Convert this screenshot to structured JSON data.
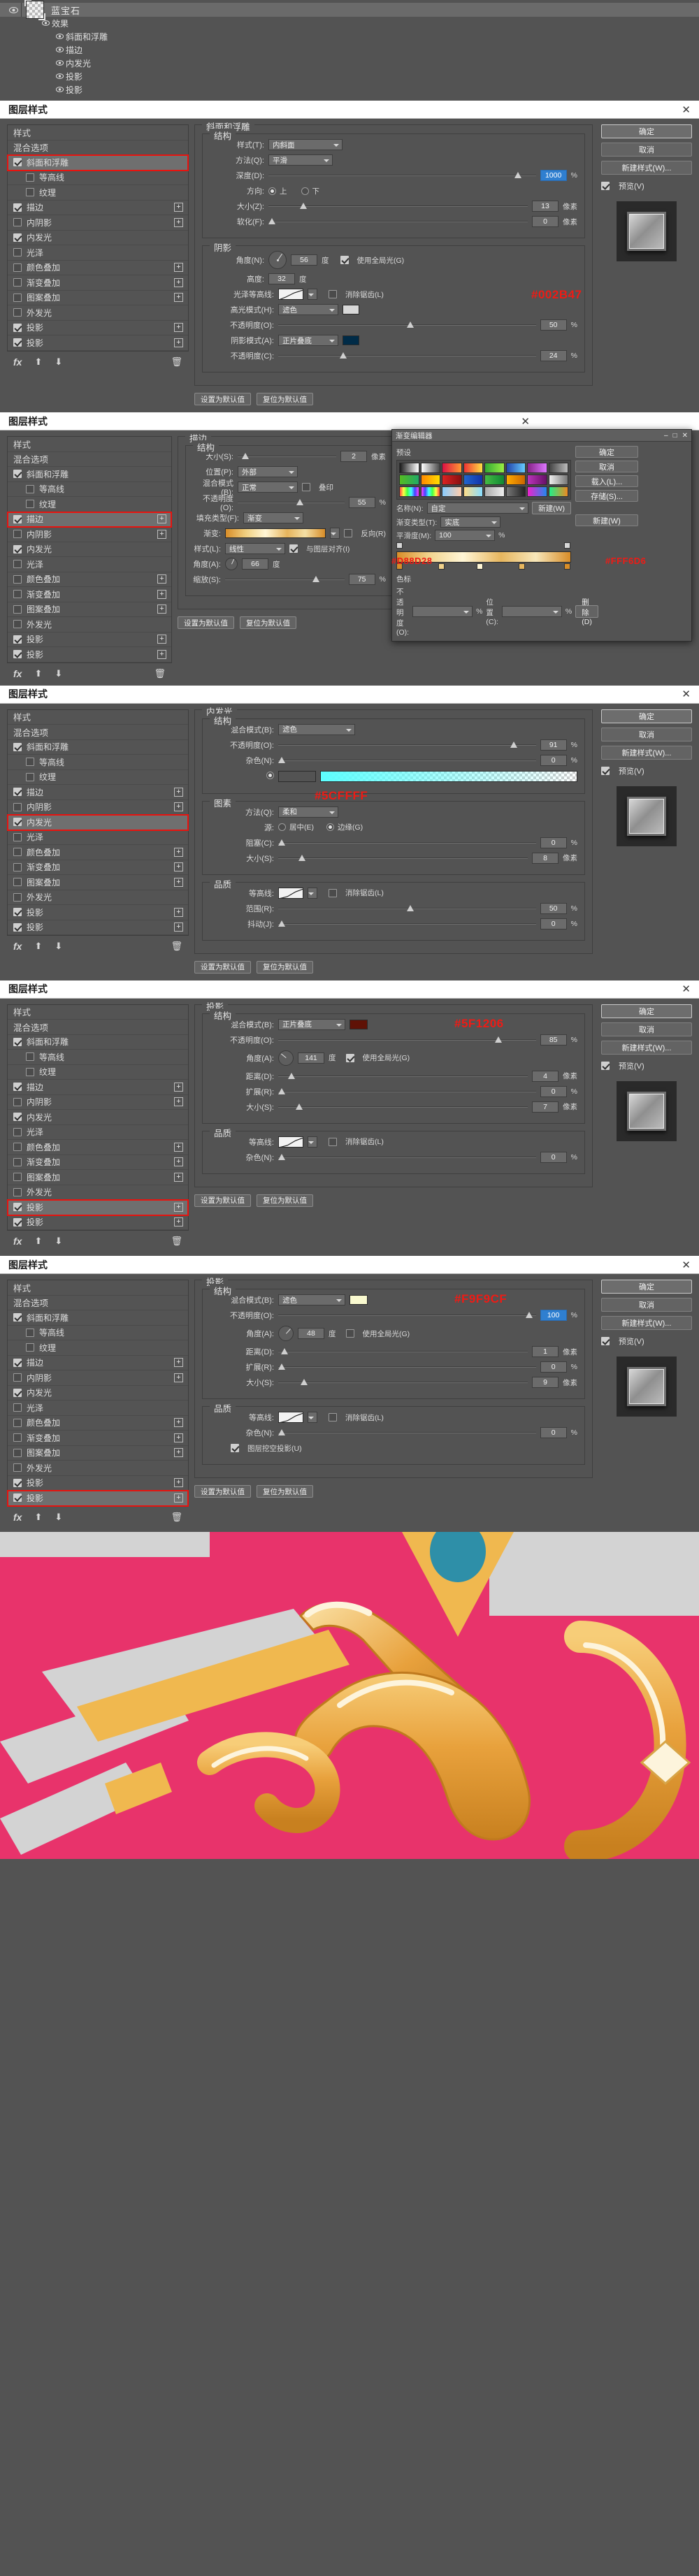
{
  "layers_panel": {
    "layer_name": "蓝宝石",
    "effects_label": "效果",
    "effects": [
      "斜面和浮雕",
      "描边",
      "内发光",
      "投影",
      "投影"
    ]
  },
  "dialog_common": {
    "title": "图层样式",
    "close": "✕",
    "buttons": {
      "ok": "确定",
      "cancel": "取消",
      "new_style": "新建样式(W)...",
      "preview": "预览(V)"
    },
    "footer": {
      "set_default": "设置为默认值",
      "reset_default": "复位为默认值"
    },
    "style_list_footer": {
      "fx": "fx",
      "up": "⬆",
      "down": "⬇",
      "trash": "🗑"
    },
    "style_items": [
      {
        "label": "样式",
        "type": "header"
      },
      {
        "label": "混合选项",
        "type": "header"
      },
      {
        "label": "斜面和浮雕",
        "type": "check",
        "checked": true,
        "plus": false
      },
      {
        "label": "等高线",
        "type": "check",
        "checked": false,
        "indent": true
      },
      {
        "label": "纹理",
        "type": "check",
        "checked": false,
        "indent": true
      },
      {
        "label": "描边",
        "type": "check",
        "checked": true,
        "plus": true
      },
      {
        "label": "内阴影",
        "type": "check",
        "checked": false,
        "plus": true
      },
      {
        "label": "内发光",
        "type": "check",
        "checked": true,
        "plus": false
      },
      {
        "label": "光泽",
        "type": "check",
        "checked": false,
        "plus": false
      },
      {
        "label": "颜色叠加",
        "type": "check",
        "checked": false,
        "plus": true
      },
      {
        "label": "渐变叠加",
        "type": "check",
        "checked": false,
        "plus": true
      },
      {
        "label": "图案叠加",
        "type": "check",
        "checked": false,
        "plus": false
      },
      {
        "label": "外发光",
        "type": "check",
        "checked": false,
        "plus": false
      },
      {
        "label": "投影",
        "type": "check",
        "checked": true,
        "plus": true
      },
      {
        "label": "投影",
        "type": "check",
        "checked": true,
        "plus": true
      }
    ]
  },
  "dialog1": {
    "selected_style": "斜面和浮雕",
    "group_title": "斜面和浮雕",
    "structure_title": "结构",
    "shading_title": "阴影",
    "fields": {
      "style_label": "样式(T):",
      "style_value": "内斜面",
      "technique_label": "方法(Q):",
      "technique_value": "平滑",
      "depth_label": "深度(D):",
      "depth_value": "1000",
      "depth_unit": "%",
      "direction_label": "方向:",
      "direction_up": "上",
      "direction_down": "下",
      "size_label": "大小(Z):",
      "size_value": "13",
      "size_unit": "像素",
      "soften_label": "软化(F):",
      "soften_value": "0",
      "soften_unit": "像素",
      "angle_label": "角度(N):",
      "angle_value": "56",
      "angle_unit": "度",
      "use_global_light": "使用全局光(G)",
      "altitude_label": "高度:",
      "altitude_value": "32",
      "altitude_unit": "度",
      "gloss_contour_label": "光泽等高线:",
      "antialias": "消除锯齿(L)",
      "highlight_mode_label": "高光模式(H):",
      "highlight_mode_value": "滤色",
      "highlight_opacity_label": "不透明度(O):",
      "highlight_opacity_value": "50",
      "highlight_opacity_unit": "%",
      "shadow_mode_label": "阴影模式(A):",
      "shadow_mode_value": "正片叠底",
      "shadow_opacity_label": "不透明度(C):",
      "shadow_opacity_value": "24",
      "shadow_opacity_unit": "%"
    },
    "colors": {
      "highlight": "#d8d8d8",
      "shadow": "#002b47"
    },
    "annotation": "#002B47"
  },
  "dialog2": {
    "selected_style": "描边",
    "group_title": "描边",
    "structure_title": "结构",
    "fields": {
      "size_label": "大小(S):",
      "size_value": "2",
      "size_unit": "像素",
      "position_label": "位置(P):",
      "position_value": "外部",
      "blend_label": "混合模式(B):",
      "blend_value": "正常",
      "opacity_label": "不透明度(O):",
      "opacity_value": "55",
      "opacity_unit": "%",
      "overprint_label": "叠印",
      "fill_type_label": "填充类型(F):",
      "fill_type_value": "渐变",
      "gradient_label": "渐变:",
      "reverse_label": "反向(R)",
      "style_label": "样式(L):",
      "style_value": "线性",
      "align_label": "与图层对齐(I)",
      "angle_label": "角度(A):",
      "angle_value": "66",
      "angle_unit": "度",
      "scale_label": "缩放(S):",
      "scale_value": "75",
      "scale_unit": "%"
    },
    "annotations": [
      "#D88D28",
      "#FFF6D6"
    ]
  },
  "gradient_picker": {
    "title": "渐变编辑器",
    "presets_label": "预设",
    "name_label": "名称(N):",
    "name_value": "自定",
    "new_label": "新建(W)",
    "grad_type_label": "渐变类型(T):",
    "grad_type_value": "实底",
    "smooth_label": "平滑度(M):",
    "smooth_value": "100",
    "smooth_unit": "%",
    "stops_label": "色标",
    "opacity_label": "不透明度(O):",
    "opacity_unit": "%",
    "location_label": "位置(C):",
    "location_unit": "%",
    "delete_label": "删除(D)",
    "buttons": {
      "ok": "确定",
      "cancel": "取消",
      "load": "载入(L)...",
      "save": "存储(S)...",
      "new": "新建(W)"
    },
    "stop_colors": [
      "#d88d28",
      "#f7e6b4",
      "#fff6d6",
      "#e3a84a",
      "#d88d28"
    ]
  },
  "dialog3": {
    "selected_style": "内发光",
    "group_title": "内发光",
    "structure_title": "结构",
    "quality_title": "品质",
    "fields": {
      "blend_label": "混合模式(B):",
      "blend_value": "滤色",
      "opacity_label": "不透明度(O):",
      "opacity_value": "91",
      "opacity_unit": "%",
      "noise_label": "杂色(N):",
      "noise_value": "0",
      "noise_unit": "%",
      "elements_title": "图素",
      "technique_label": "方法(Q):",
      "technique_value": "柔和",
      "source_label": "源:",
      "source_center": "居中(E)",
      "source_edge": "边缘(G)",
      "choke_label": "阻塞(C):",
      "choke_value": "0",
      "choke_unit": "%",
      "size_label": "大小(S):",
      "size_value": "8",
      "size_unit": "像素",
      "contour_label": "等高线:",
      "antialias": "消除锯齿(L)",
      "range_label": "范围(R):",
      "range_value": "50",
      "range_unit": "%",
      "jitter_label": "抖动(J):",
      "jitter_value": "0",
      "jitter_unit": "%"
    },
    "colors": {
      "glow": "#2ffff"
    },
    "annotation": "#5CFFFF"
  },
  "dialog4": {
    "selected_style": "投影",
    "group_title": "投影",
    "structure_title": "结构",
    "quality_title": "品质",
    "fields": {
      "blend_label": "混合模式(B):",
      "blend_value": "正片叠底",
      "opacity_label": "不透明度(O):",
      "opacity_value": "85",
      "opacity_unit": "%",
      "angle_label": "角度(A):",
      "angle_value": "141",
      "angle_unit": "度",
      "use_global_light": "使用全局光(G)",
      "distance_label": "距离(D):",
      "distance_value": "4",
      "distance_unit": "像素",
      "spread_label": "扩展(R):",
      "spread_value": "0",
      "spread_unit": "%",
      "size_label": "大小(S):",
      "size_value": "7",
      "size_unit": "像素",
      "contour_label": "等高线:",
      "antialias": "消除锯齿(L)",
      "noise_label": "杂色(N):",
      "noise_value": "0",
      "noise_unit": "%"
    },
    "colors": {
      "shadow": "#5f1206"
    },
    "annotation": "#5F1206"
  },
  "dialog5": {
    "selected_style": "投影",
    "group_title": "投影",
    "structure_title": "结构",
    "quality_title": "品质",
    "fields": {
      "blend_label": "混合模式(B):",
      "blend_value": "滤色",
      "opacity_label": "不透明度(O):",
      "opacity_value": "100",
      "opacity_unit": "%",
      "angle_label": "角度(A):",
      "angle_value": "48",
      "angle_unit": "度",
      "use_global_light": "使用全局光(G)",
      "distance_label": "距离(D):",
      "distance_value": "1",
      "distance_unit": "像素",
      "spread_label": "扩展(R):",
      "spread_value": "0",
      "spread_unit": "%",
      "size_label": "大小(S):",
      "size_value": "9",
      "size_unit": "像素",
      "layer_knockout": "图层挖空投影(U)",
      "contour_label": "等高线:",
      "antialias": "消除锯齿(L)",
      "noise_label": "杂色(N):",
      "noise_value": "0",
      "noise_unit": "%"
    },
    "colors": {
      "shadow": "#f9f9cf"
    },
    "annotation": "#F9F9CF"
  },
  "artwork": {
    "bg_pink": "#e8336b",
    "bg_gray": "#d3d3d3",
    "gold_light": "#f3c46a",
    "gold": "#e8a13c",
    "gold_dark": "#c07a1e",
    "cream": "#fdf4dc",
    "teal": "#2e8fa8"
  }
}
